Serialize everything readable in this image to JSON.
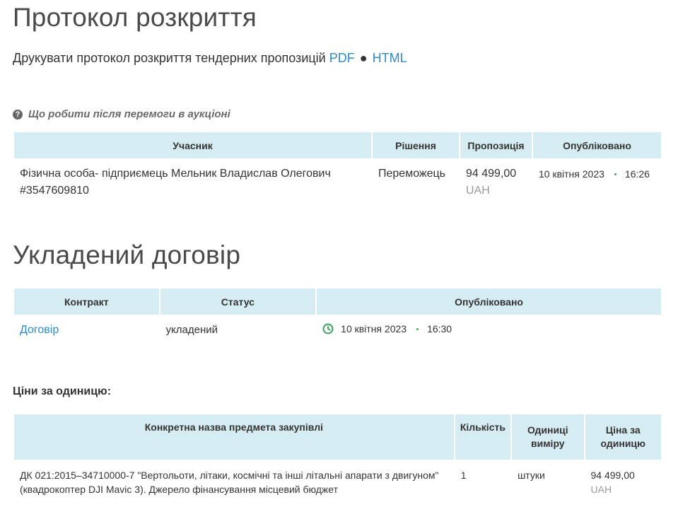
{
  "protocol": {
    "title": "Протокол розкриття",
    "print_text": "Друкувати протокол розкриття тендерних пропозицій",
    "pdf_link": "PDF",
    "separator": "●",
    "html_link": "HTML",
    "help_icon": "question-circle-icon",
    "help_link": "Що робити після перемоги в аукціоні"
  },
  "bids_table": {
    "headers": [
      "Учасник",
      "Рішення",
      "Пропозиція",
      "Опубліковано"
    ],
    "rows": [
      {
        "participant": "Фізична особа- підприємець Мельник Владислав Олегович #3547609810",
        "decision": "Переможець",
        "amount": "94 499,00",
        "currency": "UAH",
        "date": "10 квітня 2023",
        "time": "16:26"
      }
    ]
  },
  "contract": {
    "title": "Укладений договір",
    "headers": [
      "Контракт",
      "Статус",
      "Опубліковано"
    ],
    "rows": [
      {
        "contract": "Договір",
        "status": "укладений",
        "status_icon": "clock-icon",
        "date": "10 квітня 2023",
        "time": "16:30"
      }
    ]
  },
  "unit_prices": {
    "label": "Ціни за одиницю:",
    "headers": [
      "Конкретна назва предмета закупівлі",
      "Кількість",
      "Одиниці виміру",
      "Ціна за одиницю"
    ],
    "rows": [
      {
        "name": "ДК 021:2015–34710000-7 \"Вертольоти, літаки, космічні та інші літальні апарати з двигуном\" (квадрокоптер DJI Mavic 3). Джерело фінансування місцевий бюджет",
        "quantity": "1",
        "unit": "штуки",
        "price": "94 499,00",
        "currency": "UAH"
      }
    ]
  },
  "colors": {
    "link": "#2e8bc9",
    "header_bg": "#d6ecf3",
    "status_green": "#3aa35a",
    "muted": "#9a9a9a"
  }
}
